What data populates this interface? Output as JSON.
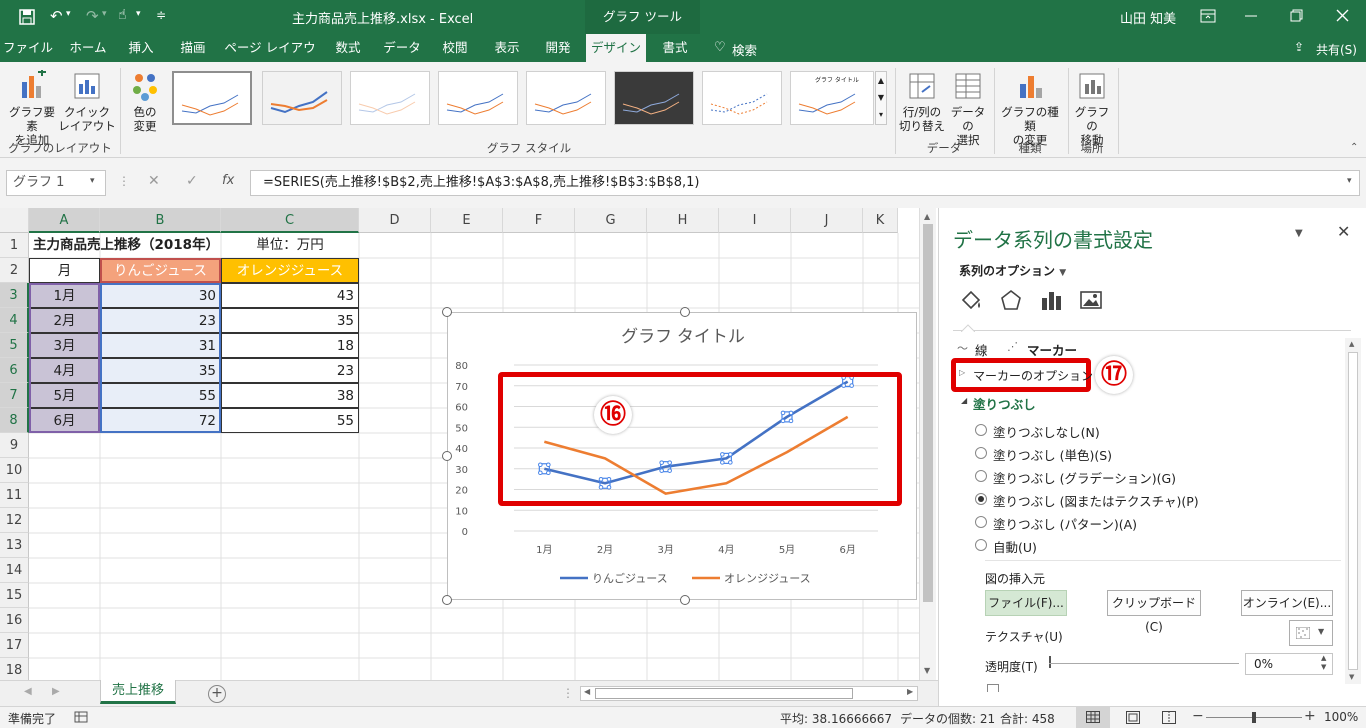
{
  "title_bar": {
    "doc_title": "主力商品売上推移.xlsx  -  Excel",
    "tool_context": "グラフ ツール",
    "user": "山田 知美"
  },
  "tabs": [
    "ファイル",
    "ホーム",
    "挿入",
    "描画",
    "ページ レイアウト",
    "数式",
    "データ",
    "校閲",
    "表示",
    "開発",
    "デザイン",
    "書式"
  ],
  "search_label": "検索",
  "share_label": "共有(S)",
  "ribbon": {
    "add_element_1": "グラフ要素",
    "add_element_2": "を追加",
    "quick_layout_1": "クイック",
    "quick_layout_2": "レイアウト",
    "layout_group": "グラフのレイアウト",
    "color_1": "色の",
    "color_2": "変更",
    "styles_group": "グラフ スタイル",
    "switch_1": "行/列の",
    "switch_2": "切り替え",
    "select_1": "データの",
    "select_2": "選択",
    "data_group": "データ",
    "change_type_1": "グラフの種類",
    "change_type_2": "の変更",
    "type_group": "種類",
    "move_1": "グラフの",
    "move_2": "移動",
    "location_group": "場所",
    "thumb_title_9": "グラフ タイトル"
  },
  "formula_bar": {
    "name_box": "グラフ 1",
    "fx": "fx",
    "formula": "=SERIES(売上推移!$B$2,売上推移!$A$3:$A$8,売上推移!$B$3:$B$8,1)"
  },
  "columns": [
    "A",
    "B",
    "C",
    "D",
    "E",
    "F",
    "G",
    "H",
    "I",
    "J",
    "K"
  ],
  "rows": [
    "1",
    "2",
    "3",
    "4",
    "5",
    "6",
    "7",
    "8",
    "9",
    "10",
    "11",
    "12",
    "13",
    "14",
    "15",
    "16",
    "17",
    "18"
  ],
  "sheet": {
    "title": "主力商品売上推移（2018年）",
    "unit": "単位：万円",
    "headers": [
      "月",
      "りんごジュース",
      "オレンジジュース"
    ],
    "data": [
      [
        "1月",
        "30",
        "43"
      ],
      [
        "2月",
        "23",
        "35"
      ],
      [
        "3月",
        "31",
        "18"
      ],
      [
        "4月",
        "35",
        "23"
      ],
      [
        "5月",
        "55",
        "38"
      ],
      [
        "6月",
        "72",
        "55"
      ]
    ]
  },
  "chart_data": {
    "type": "line",
    "title": "グラフ タイトル",
    "categories": [
      "1月",
      "2月",
      "3月",
      "4月",
      "5月",
      "6月"
    ],
    "series": [
      {
        "name": "りんごジュース",
        "values": [
          30,
          23,
          31,
          35,
          55,
          72
        ],
        "color": "#4472c4"
      },
      {
        "name": "オレンジジュース",
        "values": [
          43,
          35,
          18,
          23,
          38,
          55
        ],
        "color": "#ed7d31"
      }
    ],
    "y_ticks": [
      "0",
      "10",
      "20",
      "30",
      "40",
      "50",
      "60",
      "70",
      "80"
    ],
    "ylim": [
      0,
      80
    ],
    "grid": true,
    "legend_position": "bottom"
  },
  "annotations": {
    "circle16": "⑯",
    "circle17": "⑰"
  },
  "panel": {
    "title": "データ系列の書式設定",
    "series_options": "系列のオプション",
    "tab_line": "線",
    "tab_marker": "マーカー",
    "marker_options": "マーカーのオプション",
    "fill": "塗りつぶし",
    "fill_options": [
      "塗りつぶしなし(N)",
      "塗りつぶし (単色)(S)",
      "塗りつぶし (グラデーション)(G)",
      "塗りつぶし (図またはテクスチャ)(P)",
      "塗りつぶし (パターン)(A)",
      "自動(U)"
    ],
    "selected_fill_index": 3,
    "insert_from": "図の挿入元",
    "btn_file": "ファイル(F)...",
    "btn_clipboard": "クリップボード(C)",
    "btn_online": "オンライン(E)...",
    "texture": "テクスチャ(U)",
    "transparency": "透明度(T)",
    "transparency_value": "0%"
  },
  "sheet_tab": "売上推移",
  "status": {
    "ready": "準備完了",
    "average": "平均: 38.16666667",
    "count": "データの個数: 21",
    "sum": "合計: 458",
    "zoom": "100%"
  },
  "colors": {
    "excel_green": "#217346",
    "apple_header": "#f4a27c",
    "orange_header": "#ffc000",
    "month_fill": "#c9c3d6",
    "selected_fill": "#e8eef8",
    "annotation_red": "#e00000"
  }
}
